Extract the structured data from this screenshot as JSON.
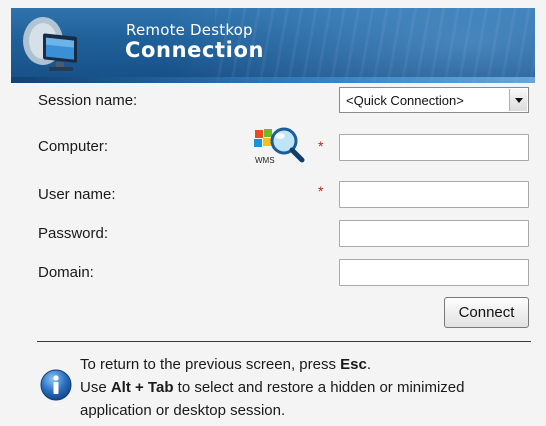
{
  "header": {
    "title_line1": "Remote Destkop",
    "title_line2": "Connection",
    "icon": "remote-desktop-monitor-icon"
  },
  "form": {
    "session": {
      "label": "Session name:",
      "selected": "<Quick Connection>"
    },
    "computer": {
      "label": "Computer:",
      "value": "",
      "required_mark": "*",
      "icon": "wms-search-icon",
      "icon_text": "WMS"
    },
    "username": {
      "label": "User name:",
      "value": "",
      "required_mark": "*"
    },
    "password": {
      "label": "Password:",
      "value": ""
    },
    "domain": {
      "label": "Domain:",
      "value": ""
    },
    "connect_label": "Connect"
  },
  "info": {
    "icon": "info-icon",
    "line1_a": "To return to the previous screen, press ",
    "line1_key": "Esc",
    "line1_b": ".",
    "line2_a": "Use ",
    "line2_key": "Alt + Tab",
    "line2_b": " to select and restore a hidden or minimized",
    "line3": "application or desktop session."
  },
  "colors": {
    "header_blue": "#1f5f99",
    "required_red": "#d11a1a",
    "info_blue": "#2a6fc0"
  }
}
